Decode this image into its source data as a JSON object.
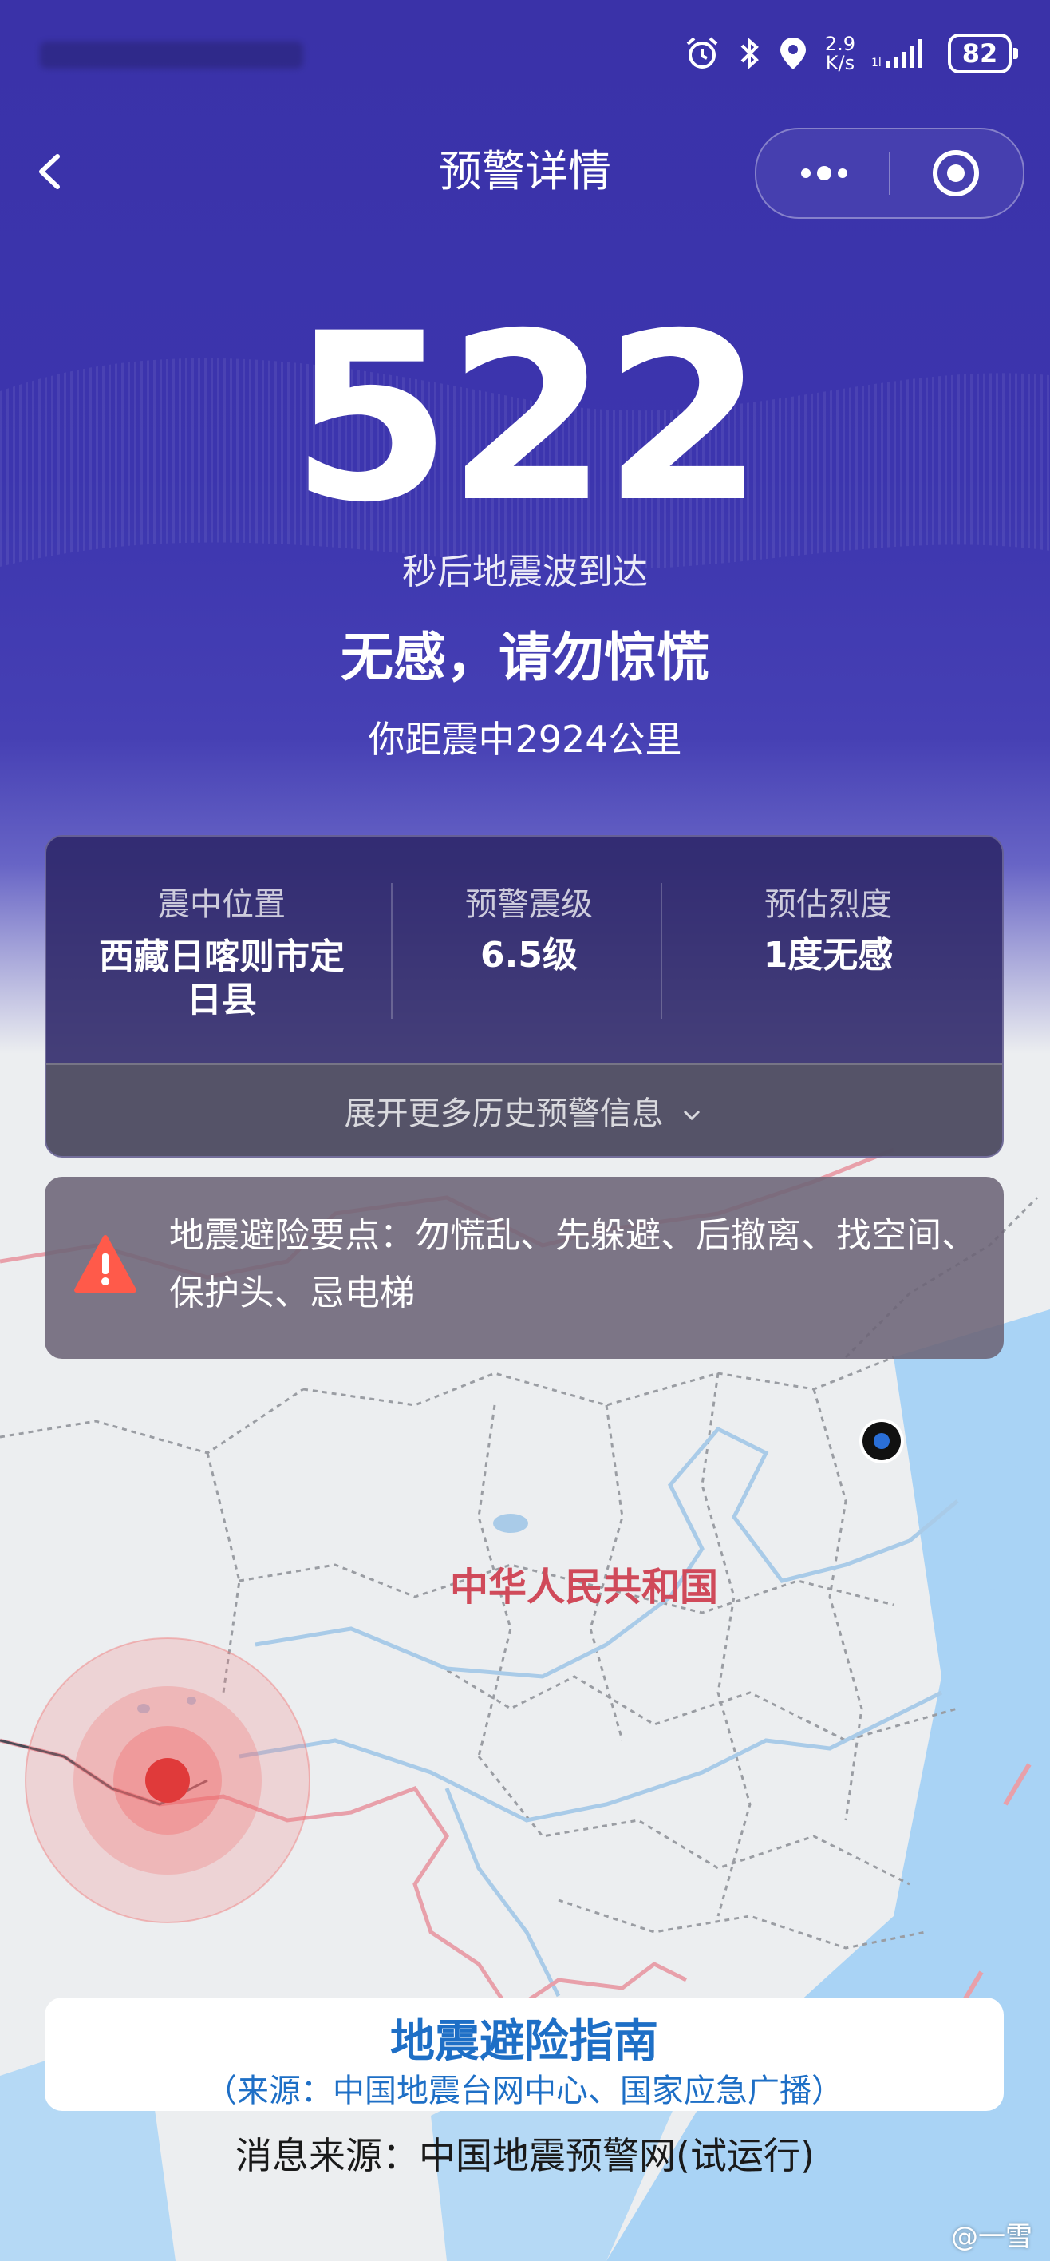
{
  "status_bar": {
    "speed_value": "2.9",
    "speed_unit": "K/s",
    "battery": "82"
  },
  "header": {
    "title": "预警详情"
  },
  "alert": {
    "countdown": "522",
    "countdown_caption": "秒后地震波到达",
    "feeling": "无感，请勿惊慌",
    "distance": "你距震中2924公里"
  },
  "info_card": {
    "columns": [
      {
        "label": "震中位置",
        "value": "西藏日喀则市定日县"
      },
      {
        "label": "预警震级",
        "value": "6.5级"
      },
      {
        "label": "预估烈度",
        "value": "1度无感"
      }
    ],
    "expand_label": "展开更多历史预警信息"
  },
  "tips": {
    "text": "地震避险要点：勿慌乱、先躲避、后撤离、找空间、保护头、忌电梯"
  },
  "map": {
    "country_label": "中华人民共和国"
  },
  "guide": {
    "title": "地震避险指南",
    "source": "（来源：中国地震台网中心、国家应急广播）"
  },
  "footer": {
    "source": "消息来源：中国地震预警网(试运行)"
  },
  "watermark": "@一雪",
  "colors": {
    "header_bg": "#3a32a8",
    "guide_text": "#1e6fc6",
    "epicenter": "#e03a3a",
    "user_location": "#2a6fd8",
    "map_label": "#d04a5a"
  }
}
